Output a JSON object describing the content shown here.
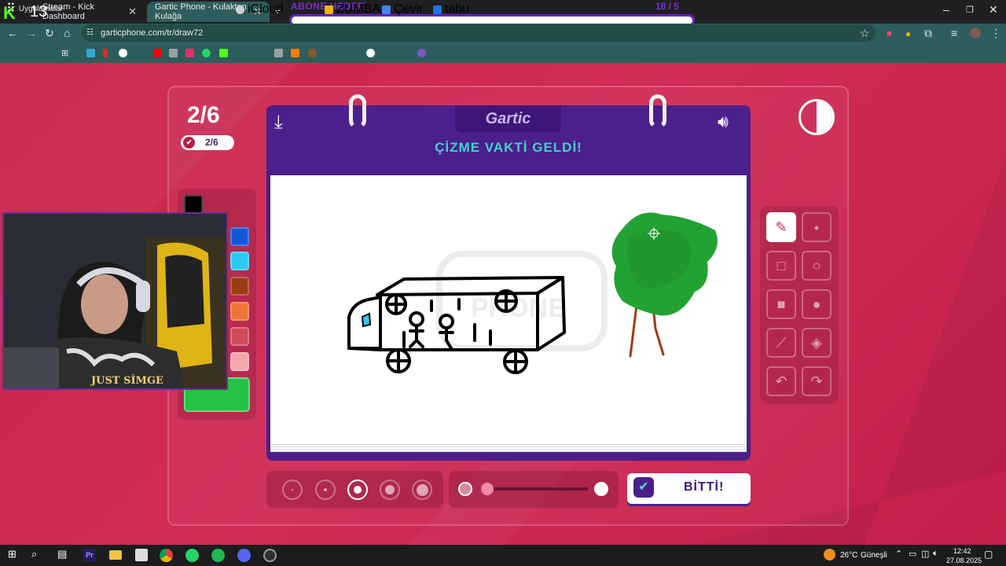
{
  "browser": {
    "tabs": [
      {
        "label": "Stream - Kick Dashboard"
      },
      {
        "label": "Gartic Phone - Kulaktan Kulağa"
      }
    ],
    "url": "garticphone.com/tr/draw72",
    "bookmarks": [
      {
        "label": "Uygulamalar",
        "color": "#e8eaed"
      },
      {
        "label": "",
        "color": "#d93025"
      },
      {
        "label": "iCloud",
        "color": "#cfcfcf"
      },
      {
        "label": "ZUMBA",
        "color": "#f4b400"
      },
      {
        "label": "Çevir",
        "color": "#4285f4"
      },
      {
        "label": "tabu",
        "color": "#1a73e8"
      }
    ]
  },
  "stream": {
    "goal_label": "ABONE HEDEFİ",
    "goal_count": "18 / 5",
    "kick_count": "13",
    "streamer_name": "JUST SİMGE"
  },
  "game": {
    "round_big": "2/6",
    "round_small": "2/6",
    "brand": "Gartic",
    "instruction": "ÇİZME VAKTİ GELDİ!",
    "done_label": "BİTTİ!",
    "palette_colors": [
      "#000000",
      "#1456d6",
      "#2ec8f5",
      "#9b3a14",
      "#f07436",
      "#cf4a5a",
      "#f5a5ac",
      "#23c244"
    ],
    "sizes": [
      1,
      2,
      3,
      4,
      5
    ],
    "selected_size": 3
  },
  "taskbar": {
    "weather": "26°C",
    "weather_desc": "Güneşli",
    "time": "12:42",
    "date": "27.08.2025"
  }
}
